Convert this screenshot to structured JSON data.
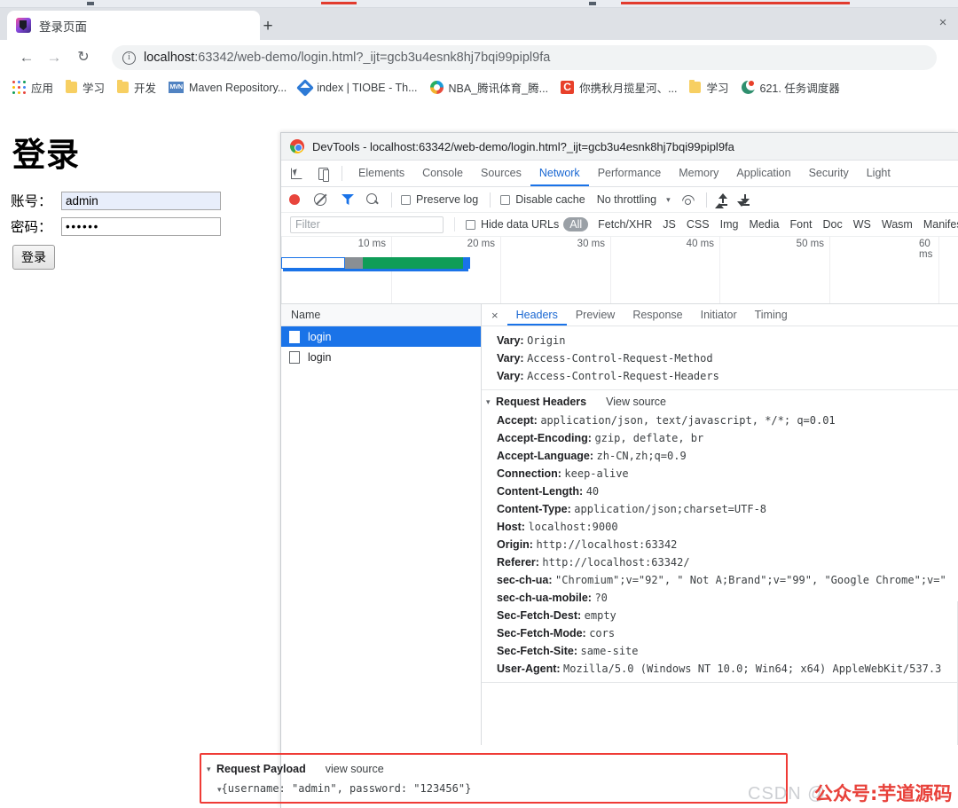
{
  "browser": {
    "tab": {
      "title": "登录页面",
      "favicon": "intellij-idea-icon",
      "close_label": "×"
    },
    "new_tab_label": "+",
    "nav": {
      "back": "←",
      "forward": "→",
      "reload": "↻"
    },
    "omnibox": {
      "info_icon": "ⓘ",
      "url_host": "localhost",
      "url_rest": ":63342/web-demo/login.html?_ijt=gcb3u4esnk8hj7bqi99pipl9fa"
    },
    "bookmarks": [
      {
        "label": "应用",
        "icon": "apps-grid-icon"
      },
      {
        "label": "学习",
        "icon": "folder-icon"
      },
      {
        "label": "开发",
        "icon": "folder-icon"
      },
      {
        "label": "Maven Repository...",
        "icon": "maven-icon"
      },
      {
        "label": "index | TIOBE - Th...",
        "icon": "tiobe-icon"
      },
      {
        "label": "NBA_腾讯体育_腾...",
        "icon": "tencent-sports-icon"
      },
      {
        "label": "你携秋月揽星河、...",
        "icon": "csdn-icon"
      },
      {
        "label": "学习",
        "icon": "folder-icon"
      },
      {
        "label": "621. 任务调度器",
        "icon": "leetcode-icon"
      }
    ]
  },
  "login_page": {
    "heading": "登录",
    "username_label": "账号：",
    "username_value": "admin",
    "username_placeholder": "",
    "password_label": "密码：",
    "password_value": "••••••",
    "password_placeholder": "",
    "submit_label": "登录"
  },
  "devtools": {
    "window_title": "DevTools - localhost:63342/web-demo/login.html?_ijt=gcb3u4esnk8hj7bqi99pipl9fa",
    "logo_icon": "chrome-logo-icon",
    "tool_icons": [
      {
        "name": "inspect-element-icon"
      },
      {
        "name": "device-toolbar-icon"
      }
    ],
    "panels": [
      {
        "label": "Elements",
        "active": false
      },
      {
        "label": "Console",
        "active": false
      },
      {
        "label": "Sources",
        "active": false
      },
      {
        "label": "Network",
        "active": true
      },
      {
        "label": "Performance",
        "active": false
      },
      {
        "label": "Memory",
        "active": false
      },
      {
        "label": "Application",
        "active": false
      },
      {
        "label": "Security",
        "active": false
      },
      {
        "label": "Light",
        "active": false
      }
    ],
    "controls": {
      "record_icon": "record-button-icon",
      "clear_icon": "clear-icon",
      "filter_icon": "filter-icon",
      "search_icon": "search-icon",
      "preserve_log_label": "Preserve log",
      "preserve_log_checked": false,
      "disable_cache_label": "Disable cache",
      "disable_cache_checked": false,
      "throttling_value": "No throttling",
      "throttling_caret": "▾",
      "wifi_icon": "network-conditions-icon",
      "import_icon": "import-har-icon",
      "export_icon": "export-har-icon"
    },
    "filterbar": {
      "filter_placeholder": "Filter",
      "filter_value": "",
      "hide_data_urls_label": "Hide data URLs",
      "hide_data_urls_checked": false,
      "types": [
        "All",
        "Fetch/XHR",
        "JS",
        "CSS",
        "Img",
        "Media",
        "Font",
        "Doc",
        "WS",
        "Wasm",
        "Manifest"
      ],
      "active_type": "All"
    },
    "overview": {
      "ticks": [
        "10 ms",
        "20 ms",
        "30 ms",
        "40 ms",
        "50 ms",
        "60 ms"
      ],
      "bar_segments": [
        {
          "name": "queue",
          "color": "#ffffff"
        },
        {
          "name": "stalled",
          "color": "#8a8f94"
        },
        {
          "name": "download",
          "color": "#0f9d58"
        },
        {
          "name": "finish",
          "color": "#1a73e8"
        }
      ]
    },
    "requests": {
      "column_header": "Name",
      "rows": [
        {
          "name": "login",
          "selected": true,
          "icon": "document-icon"
        },
        {
          "name": "login",
          "selected": false,
          "icon": "document-icon"
        }
      ]
    },
    "details": {
      "close_label": "×",
      "tabs": [
        {
          "label": "Headers",
          "active": true
        },
        {
          "label": "Preview",
          "active": false
        },
        {
          "label": "Response",
          "active": false
        },
        {
          "label": "Initiator",
          "active": false
        },
        {
          "label": "Timing",
          "active": false
        }
      ],
      "vary_headers": [
        {
          "key": "Vary:",
          "value": "Origin"
        },
        {
          "key": "Vary:",
          "value": "Access-Control-Request-Method"
        },
        {
          "key": "Vary:",
          "value": "Access-Control-Request-Headers"
        }
      ],
      "request_headers_section": {
        "title": "Request Headers",
        "view_source": "View source",
        "triangle": "▾"
      },
      "request_headers": [
        {
          "key": "Accept:",
          "value": "application/json, text/javascript, */*; q=0.01"
        },
        {
          "key": "Accept-Encoding:",
          "value": "gzip, deflate, br"
        },
        {
          "key": "Accept-Language:",
          "value": "zh-CN,zh;q=0.9"
        },
        {
          "key": "Connection:",
          "value": "keep-alive"
        },
        {
          "key": "Content-Length:",
          "value": "40"
        },
        {
          "key": "Content-Type:",
          "value": "application/json;charset=UTF-8"
        },
        {
          "key": "Host:",
          "value": "localhost:9000"
        },
        {
          "key": "Origin:",
          "value": "http://localhost:63342"
        },
        {
          "key": "Referer:",
          "value": "http://localhost:63342/"
        },
        {
          "key": "sec-ch-ua:",
          "value": "\"Chromium\";v=\"92\", \" Not A;Brand\";v=\"99\", \"Google Chrome\";v=\""
        },
        {
          "key": "sec-ch-ua-mobile:",
          "value": "?0"
        },
        {
          "key": "Sec-Fetch-Dest:",
          "value": "empty"
        },
        {
          "key": "Sec-Fetch-Mode:",
          "value": "cors"
        },
        {
          "key": "Sec-Fetch-Site:",
          "value": "same-site"
        },
        {
          "key": "User-Agent:",
          "value": "Mozilla/5.0 (Windows NT 10.0; Win64; x64) AppleWebKit/537.3"
        }
      ],
      "request_payload_section": {
        "title": "Request Payload",
        "view_source": "view source",
        "triangle": "▾",
        "inner_triangle": "▾",
        "body": "{username: \"admin\", password: \"123456\"}",
        "highlight_color": "#ef3b36"
      }
    }
  },
  "watermarks": {
    "csdn": "CSDN @",
    "red_text": "公众号:芋道源码",
    "red_color": "#e8413a"
  }
}
